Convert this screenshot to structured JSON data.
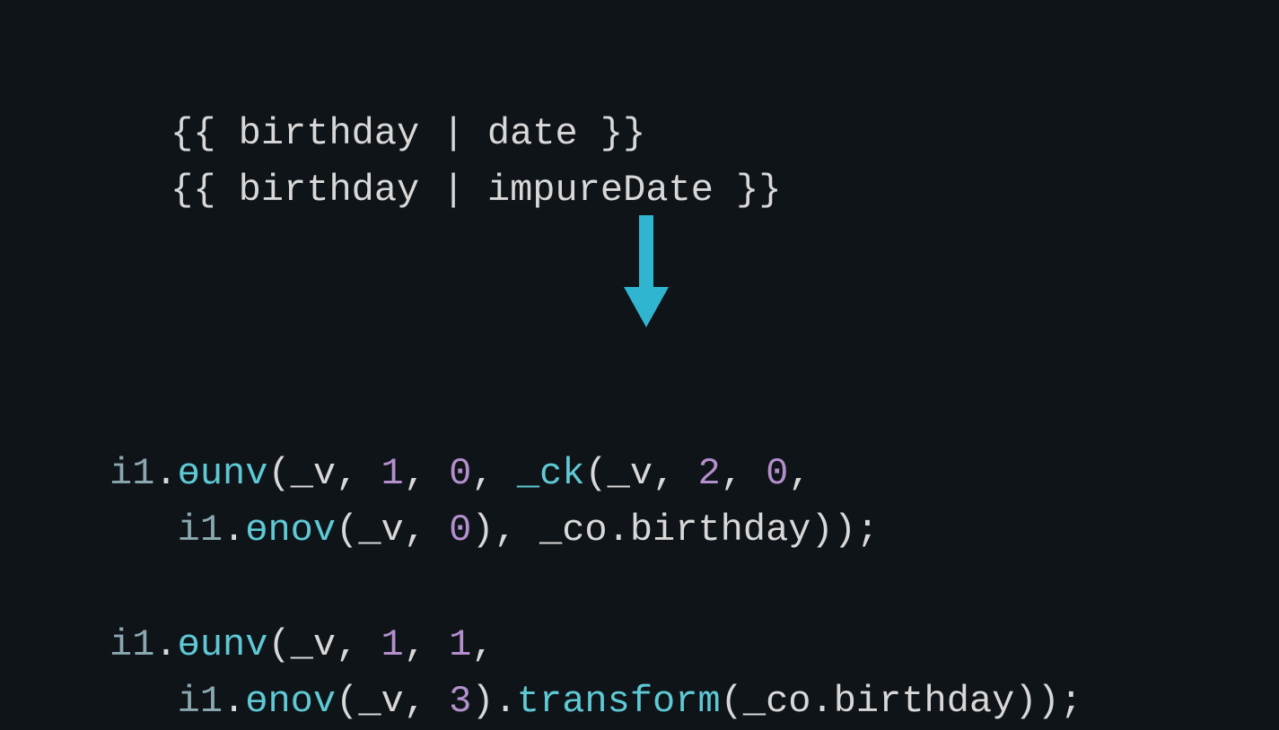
{
  "template": {
    "line1": {
      "open": "{{ ",
      "var": "birthday",
      "pipe": " | ",
      "filter": "date",
      "close": " }}"
    },
    "line2": {
      "open": "{{ ",
      "var": "birthday",
      "pipe": " | ",
      "filter": "impureDate",
      "close": " }}"
    }
  },
  "compiled1": {
    "obj1": "i1",
    "dot1": ".",
    "m1": "ɵunv",
    "p1": "(",
    "v1": "_v",
    "c1": ", ",
    "n1": "1",
    "c2": ", ",
    "n2": "0",
    "c3": ", ",
    "m2": "_ck",
    "p2": "(",
    "v2": "_v",
    "c4": ", ",
    "n3": "2",
    "c5": ", ",
    "n4": "0",
    "c6": ",",
    "indent": "   ",
    "obj2": "i1",
    "dot2": ".",
    "m3": "ɵnov",
    "p3": "(",
    "v3": "_v",
    "c7": ", ",
    "n5": "0",
    "p4": "), ",
    "co": "_co",
    "dot3": ".",
    "prop": "birthday",
    "end": "));"
  },
  "compiled2": {
    "obj1": "i1",
    "dot1": ".",
    "m1": "ɵunv",
    "p1": "(",
    "v1": "_v",
    "c1": ", ",
    "n1": "1",
    "c2": ", ",
    "n2": "1",
    "c3": ",",
    "indent": "   ",
    "obj2": "i1",
    "dot2": ".",
    "m2": "ɵnov",
    "p2": "(",
    "v2": "_v",
    "c4": ", ",
    "n3": "3",
    "p3": ").",
    "trans": "transform",
    "p4": "(",
    "co": "_co",
    "dot3": ".",
    "prop": "birthday",
    "end": "));"
  }
}
